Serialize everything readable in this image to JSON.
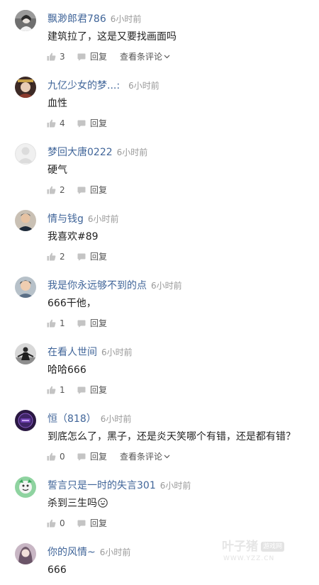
{
  "icons": {
    "like": "thumbs-up-icon",
    "reply": "comment-bubble-icon",
    "more": "chevron-down-icon",
    "emoji": "smiley-face-emoji"
  },
  "colors": {
    "username": "#406599",
    "meta": "#999999",
    "body_text": "#222222",
    "action_icon": "#c4c4c4"
  },
  "comments": [
    {
      "username": "飘渺郎君786",
      "time": "6小时前",
      "text": "建筑拉了，这是又要找画面吗",
      "likes": "3",
      "reply_label": "回复",
      "more_label": "查看条评论"
    },
    {
      "username": "九亿少女的梦...:",
      "time": "6小时前",
      "text": "血性",
      "likes": "4",
      "reply_label": "回复"
    },
    {
      "username": "梦回大唐0222",
      "time": "6小时前",
      "text": "硬气",
      "likes": "2",
      "reply_label": "回复"
    },
    {
      "username": "情与钱g",
      "time": "6小时前",
      "text": "我喜欢#89",
      "likes": "2",
      "reply_label": "回复"
    },
    {
      "username": "我是你永远够不到的点",
      "time": "6小时前",
      "text": "666干他，",
      "likes": "1",
      "reply_label": "回复"
    },
    {
      "username": "在看人世间",
      "time": "6小时前",
      "text": "哈哈666",
      "likes": "1",
      "reply_label": "回复"
    },
    {
      "username": "恒（818）",
      "time": "6小时前",
      "text": "到底怎么了，黑子，还是炎天笑哪个有错，还是都有错？",
      "likes": "0",
      "reply_label": "回复",
      "more_label": "查看条评论"
    },
    {
      "username": "誓言只是一时的失言301",
      "time": "6小时前",
      "text": "杀到三生吗",
      "likes": "0",
      "reply_label": "回复"
    },
    {
      "username": "你的风情~",
      "time": "6小时前",
      "text": "666"
    }
  ],
  "watermark": {
    "brand": "叶子猪",
    "tag": "游戏网",
    "url": "WWW.YZZ.CN"
  }
}
